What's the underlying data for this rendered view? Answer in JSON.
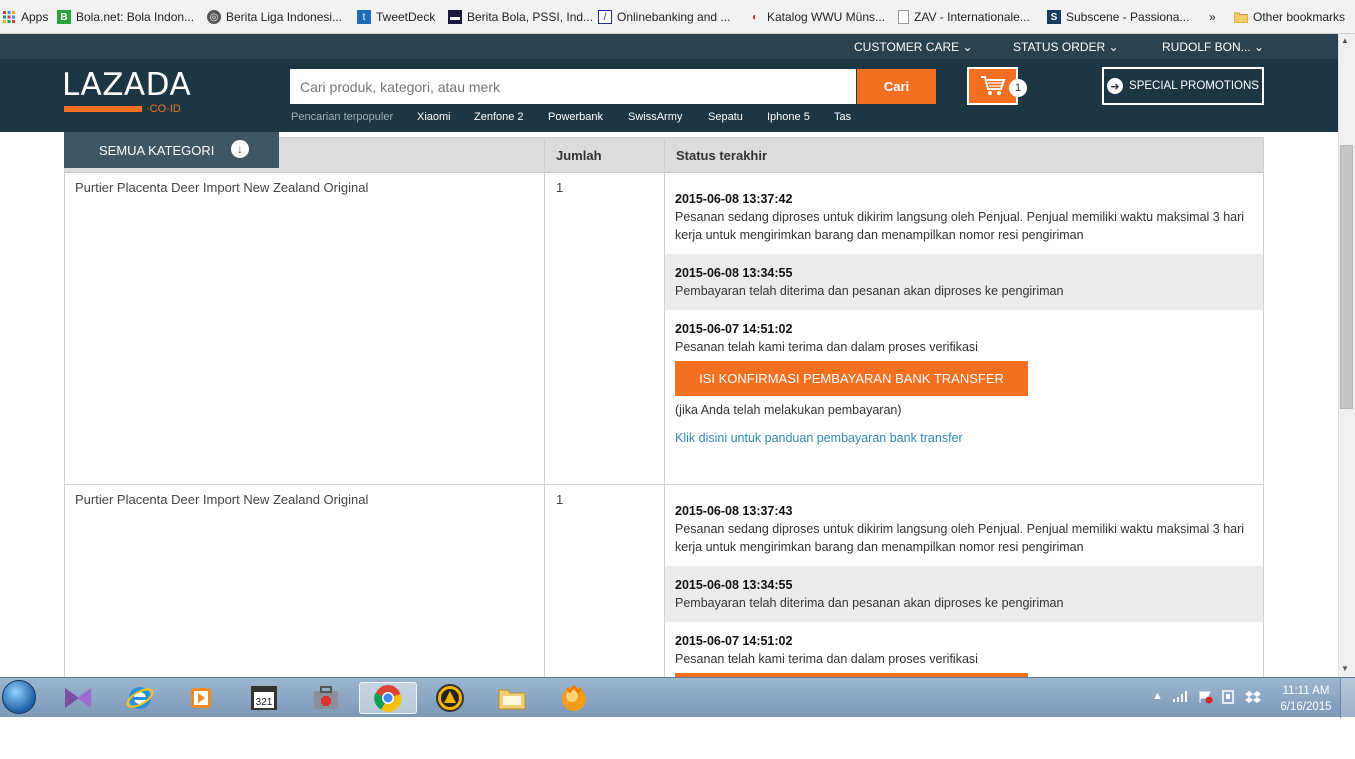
{
  "bookmarks": [
    {
      "label": "Apps",
      "icon": "apps-grid-icon"
    },
    {
      "label": "Bola.net: Bola Indon...",
      "icon": "bola-favicon"
    },
    {
      "label": "Berita Liga Indonesi...",
      "icon": "globe-icon"
    },
    {
      "label": "TweetDeck",
      "icon": "tweetdeck-icon"
    },
    {
      "label": "Berita Bola, PSSI, Ind...",
      "icon": "news-favicon"
    },
    {
      "label": "Onlinebanking and ...",
      "icon": "bank-favicon"
    },
    {
      "label": "Katalog WWU Müns...",
      "icon": "catalog-favicon"
    },
    {
      "label": "ZAV - Internationale...",
      "icon": "page-icon"
    },
    {
      "label": "Subscene - Passiona...",
      "icon": "subscene-favicon"
    }
  ],
  "bookmarks_more": "»",
  "other_bookmarks": "Other bookmarks",
  "topbar": {
    "customer_care": "CUSTOMER CARE ⌄",
    "status_order": "STATUS ORDER ⌄",
    "user": "RUDOLF BON... ⌄"
  },
  "header": {
    "logo_text": "LAZADA",
    "logo_sub": "·CO·ID",
    "search_placeholder": "Cari produk, kategori, atau merk",
    "search_button": "Cari",
    "cart_count": "1",
    "promo": "SPECIAL PROMOTIONS",
    "popular_label": "Pencarian terpopuler",
    "popular": [
      "Xiaomi",
      "Zenfone 2",
      "Powerbank",
      "SwissArmy",
      "Sepatu",
      "Iphone 5",
      "Tas"
    ]
  },
  "category_button": "SEMUA KATEGORI",
  "table": {
    "headers": [
      "Jumlah",
      "Status terakhir"
    ],
    "rows": [
      {
        "product": "Purtier Placenta Deer Import New Zealand Original",
        "qty": "1",
        "events": [
          {
            "time": "2015-06-08 13:37:42",
            "desc": "Pesanan sedang diproses untuk dikirim langsung oleh Penjual. Penjual memiliki waktu maksimal 3 hari kerja untuk mengirimkan barang dan menampilkan nomor resi pengiriman"
          },
          {
            "time": "2015-06-08 13:34:55",
            "desc": "Pembayaran telah diterima dan pesanan akan diproses ke pengiriman"
          },
          {
            "time": "2015-06-07 14:51:02",
            "desc": "Pesanan telah kami terima dan dalam proses verifikasi"
          }
        ],
        "confirm_button": "ISI KONFIRMASI PEMBAYARAN BANK TRANSFER",
        "note": "(jika Anda telah melakukan pembayaran)",
        "link": "Klik disini untuk panduan pembayaran bank transfer"
      },
      {
        "product": "Purtier Placenta Deer Import New Zealand Original",
        "qty": "1",
        "events": [
          {
            "time": "2015-06-08 13:37:43",
            "desc": "Pesanan sedang diproses untuk dikirim langsung oleh Penjual. Penjual memiliki waktu maksimal 3 hari kerja untuk mengirimkan barang dan menampilkan nomor resi pengiriman"
          },
          {
            "time": "2015-06-08 13:34:55",
            "desc": "Pembayaran telah diterima dan pesanan akan diproses ke pengiriman"
          },
          {
            "time": "2015-06-07 14:51:02",
            "desc": "Pesanan telah kami terima dan dalam proses verifikasi"
          }
        ]
      }
    ]
  },
  "taskbar": {
    "apps": [
      "visual-studio-icon",
      "internet-explorer-icon",
      "media-player-icon",
      "media-player-classic-icon",
      "toolbox-icon",
      "chrome-icon",
      "aimp-icon",
      "file-explorer-icon",
      "orange-app-icon"
    ],
    "time": "11:11 AM",
    "date": "6/16/2015"
  },
  "colors": {
    "brand_orange": "#f36f21",
    "header_dark": "#1d3644",
    "link_blue": "#2e8bb8"
  }
}
